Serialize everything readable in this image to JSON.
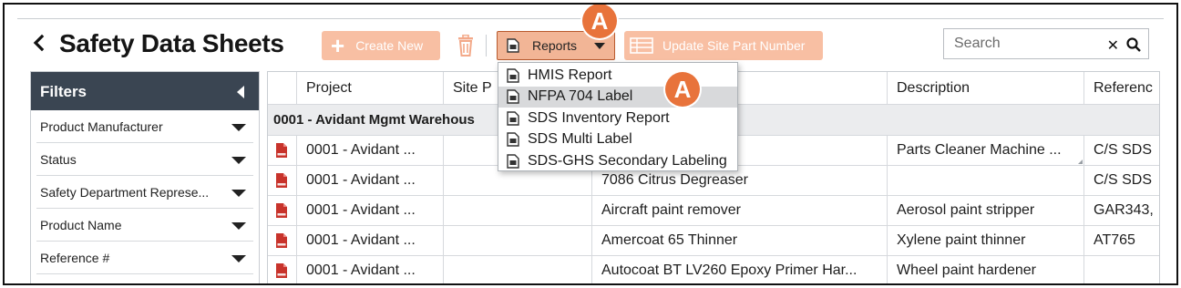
{
  "header": {
    "back_label": "<",
    "title": "Safety Data Sheets",
    "create_label": "Create New",
    "reports_label": "Reports",
    "update_label": "Update Site Part Number",
    "search_placeholder": "Search"
  },
  "annotations": [
    "A",
    "A"
  ],
  "reports_menu": [
    {
      "label": "HMIS Report",
      "icon": "document-icon"
    },
    {
      "label": "NFPA 704 Label",
      "icon": "document-icon",
      "highlighted": true
    },
    {
      "label": "SDS Inventory Report",
      "icon": "document-icon"
    },
    {
      "label": "SDS Multi Label",
      "icon": "document-icon"
    },
    {
      "label": "SDS-GHS Secondary Labeling",
      "icon": "document-icon"
    }
  ],
  "filters": {
    "title": "Filters",
    "items": [
      "Product Manufacturer",
      "Status",
      "Safety Department Represe...",
      "Product Name",
      "Reference #"
    ]
  },
  "table": {
    "columns": [
      "Project",
      "Site P",
      "",
      "Description",
      "Referenc"
    ],
    "group_label": "0001 - Avidant Mgmt Warehous",
    "rows": [
      {
        "project": "0001 - Avidant ...",
        "site": "",
        "name": "",
        "description": "Parts Cleaner Machine ...",
        "reference": "C/S SDS"
      },
      {
        "project": "0001 - Avidant ...",
        "site": "",
        "name": "7086 Citrus Degreaser",
        "description": "",
        "reference": "C/S SDS"
      },
      {
        "project": "0001 - Avidant ...",
        "site": "",
        "name": "Aircraft paint remover",
        "description": "Aerosol paint stripper",
        "reference": "GAR343,"
      },
      {
        "project": "0001 - Avidant ...",
        "site": "",
        "name": "Amercoat 65 Thinner",
        "description": "Xylene paint thinner",
        "reference": "AT765"
      },
      {
        "project": "0001 - Avidant ...",
        "site": "",
        "name": "Autocoat BT LV260 Epoxy Primer Har...",
        "description": "Wheel paint hardener",
        "reference": ""
      }
    ]
  },
  "colors": {
    "accent_orange": "#f8bfa3",
    "marker_orange": "#e8733b",
    "filters_header": "#3a4552",
    "pdf_red": "#c8332b"
  }
}
